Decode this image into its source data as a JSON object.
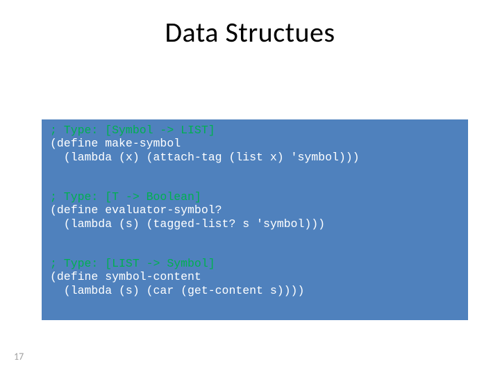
{
  "slide": {
    "title": "Data Structues",
    "page_number": "17"
  },
  "code": {
    "block1": {
      "comment": "; Type: [Symbol -> LIST]",
      "line1": "(define make-symbol",
      "line2": "  (lambda (x) (attach-tag (list x) 'symbol)))"
    },
    "block2": {
      "comment": "; Type: [T -> Boolean]",
      "line1": "(define evaluator-symbol?",
      "line2": "  (lambda (s) (tagged-list? s 'symbol)))"
    },
    "block3": {
      "comment": "; Type: [LIST -> Symbol]",
      "line1": "(define symbol-content",
      "line2": "  (lambda (s) (car (get-content s))))"
    }
  }
}
